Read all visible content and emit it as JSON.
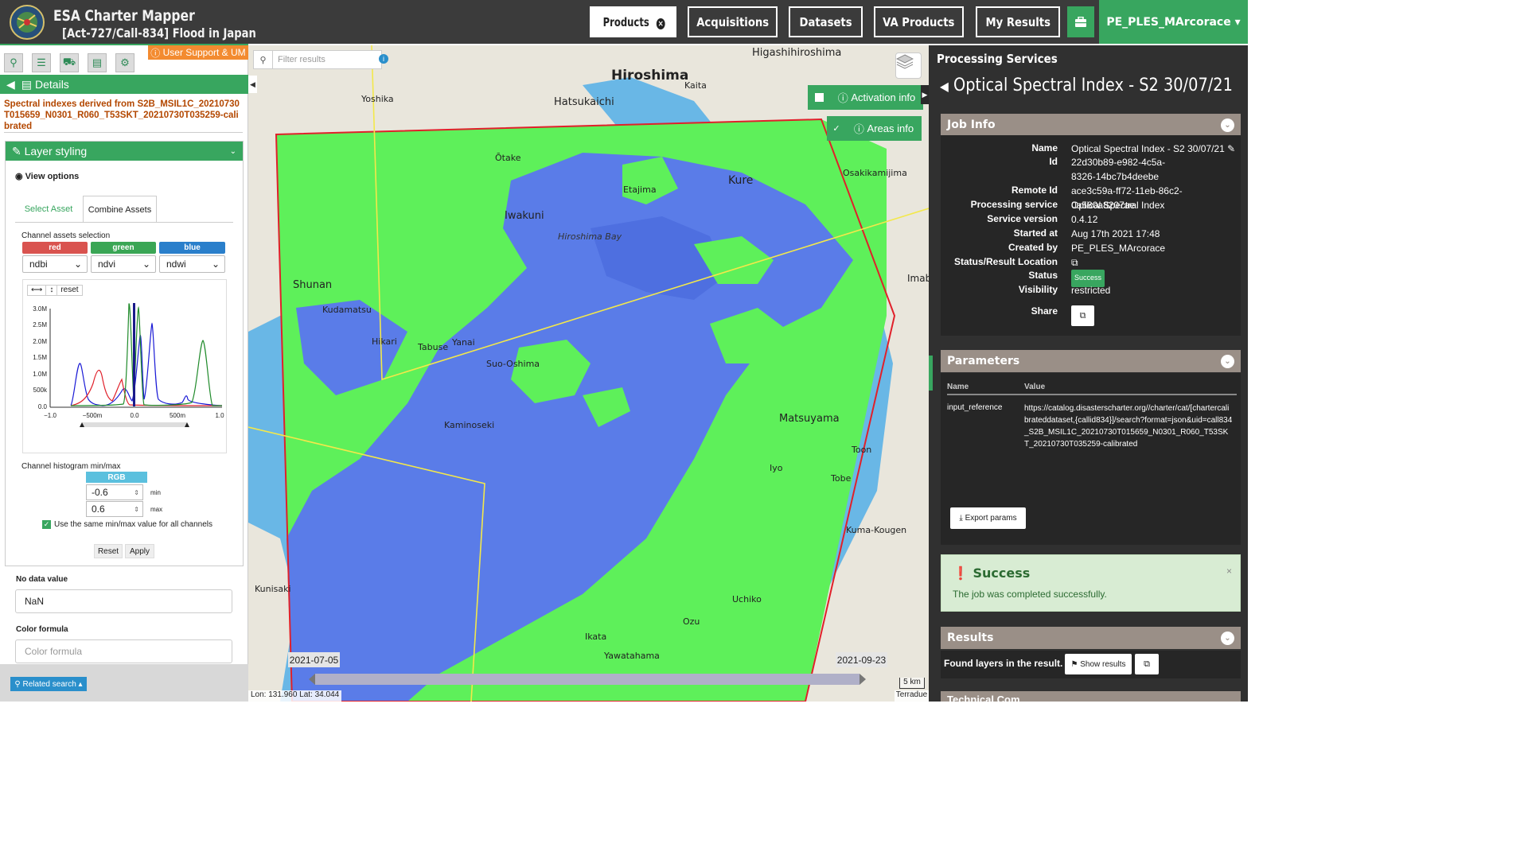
{
  "header": {
    "app_title": "ESA Charter Mapper",
    "activation_title": "[Act-727/Call-834] Flood in Japan",
    "nav": [
      {
        "label": "Products",
        "badge": "×"
      },
      {
        "label": "Acquisitions"
      },
      {
        "label": "Datasets"
      },
      {
        "label": "VA Products"
      },
      {
        "label": "My Results"
      }
    ],
    "user": "PE_PLES_MArcorace ▾"
  },
  "left": {
    "support_label": "User Support & UM",
    "details_label": "Details",
    "layer_name": "Spectral indexes derived from S2B_MSIL1C_20210730T015659_N0301_R060_T53SKT_20210730T035259-calibrated",
    "layer_styling": "Layer styling",
    "view_options": "View options",
    "tabs": [
      "Select Asset",
      "Combine Assets"
    ],
    "channel_label": "Channel assets selection",
    "channels": [
      {
        "name": "red",
        "asset": "ndbi",
        "color": "#d9534f"
      },
      {
        "name": "green",
        "asset": "ndvi",
        "color": "#3aa655"
      },
      {
        "name": "blue",
        "asset": "ndwi",
        "color": "#2a7fcb"
      }
    ],
    "hist_tools": [
      "⟷",
      "↕",
      "reset"
    ],
    "hist_y_ticks": [
      "3.0M",
      "2.5M",
      "2.0M",
      "1.5M",
      "1.0M",
      "500k",
      "0.0"
    ],
    "hist_x_ticks": [
      "−1.0",
      "−500m",
      "0.0",
      "500m",
      "1.0"
    ],
    "minmax_label": "Channel histogram min/max",
    "rgb_label": "RGB",
    "min_value": "-0.6",
    "max_value": "0.6",
    "min_lab": "min",
    "max_lab": "max",
    "same_minmax": "Use the same min/max value for all channels",
    "reset_btn": "Reset",
    "apply_btn": "Apply",
    "nodata_label": "No data value",
    "nodata_value": "NaN",
    "formula_label": "Color formula",
    "formula_placeholder": "Color formula",
    "related_search": "Related search ▴"
  },
  "map": {
    "filter_placeholder": "Filter results",
    "activation_info": "Activation info",
    "areas_info": "Areas info",
    "date_start": "2021-07-05",
    "date_end": "2021-09-23",
    "coords": "Lon: 131.960 Lat: 34.044",
    "scale": "5 km",
    "attribution": "Terradue",
    "places": [
      {
        "name": "Higashihiroshima"
      },
      {
        "name": "Hiroshima"
      },
      {
        "name": "Kaita"
      },
      {
        "name": "Hatsukaichi"
      },
      {
        "name": "Yoshika"
      },
      {
        "name": "Ōtake"
      },
      {
        "name": "Kure"
      },
      {
        "name": "Etajima"
      },
      {
        "name": "Iwakuni"
      },
      {
        "name": "Hiroshima Bay"
      },
      {
        "name": "Osakikamijima"
      },
      {
        "name": "Shunan"
      },
      {
        "name": "Kudamatsu"
      },
      {
        "name": "Hikari"
      },
      {
        "name": "Tabuse"
      },
      {
        "name": "Yanai"
      },
      {
        "name": "Suo-Oshima"
      },
      {
        "name": "Imab"
      },
      {
        "name": "Kaminoseki"
      },
      {
        "name": "Matsuyama"
      },
      {
        "name": "Toon"
      },
      {
        "name": "Tobe"
      },
      {
        "name": "Iyo"
      },
      {
        "name": "Kuma-Kougen"
      },
      {
        "name": "Kunisaki"
      },
      {
        "name": "Uchiko"
      },
      {
        "name": "Ozu"
      },
      {
        "name": "Yawatahama"
      },
      {
        "name": "Ikata"
      }
    ]
  },
  "right": {
    "panel_title": "Processing Services",
    "job_title": "Optical Spectral Index - S2 30/07/21",
    "job_info_label": "Job Info",
    "job_info": [
      {
        "key": "Name",
        "value": "Optical Spectral Index - S2 30/07/21 ✎"
      },
      {
        "key": "Id",
        "value": "22d30b89-e982-4c5a-8326-14bc7b4deebe"
      },
      {
        "key": "Remote Id",
        "value": "ace3c59a-ff72-11eb-86c2-0a580a8207ae"
      },
      {
        "key": "Processing service",
        "value": "Optical Spectral Index"
      },
      {
        "key": "Service version",
        "value": "0.4.12"
      },
      {
        "key": "Started at",
        "value": "Aug 17th 2021 17:48"
      },
      {
        "key": "Created by",
        "value": "PE_PLES_MArcorace"
      },
      {
        "key": "Status/Result Location",
        "value": "⧉"
      },
      {
        "key": "Status",
        "value": "Success"
      },
      {
        "key": "Visibility",
        "value": "restricted"
      },
      {
        "key": "Share",
        "value": "⧉"
      }
    ],
    "parameters_label": "Parameters",
    "param_header_name": "Name",
    "param_header_value": "Value",
    "param_name": "input_reference",
    "param_value": "https://catalog.disasterscharter.org//charter/cat/[chartercalibrateddataset,{callid834}]/search?format=json&uid=call834_S2B_MSIL1C_20210730T015659_N0301_R060_T53SKT_20210730T035259-calibrated",
    "export_params": "Export params",
    "success_title": "Success",
    "success_msg": "The job was completed successfully.",
    "results_label": "Results",
    "found_layers": "Found layers in the result.",
    "show_results": "Show results",
    "technical": "Technical Com..."
  },
  "colors": {
    "brand_green": "#38a65f",
    "topbar": "#3b3b3b",
    "support_orange": "#f38b30",
    "map_green": "#5ef05a",
    "map_blue": "#5a7ce8",
    "sea": "#69b7e6",
    "aoi_red": "#e0202a",
    "footprint_yellow": "#f3e84a"
  }
}
